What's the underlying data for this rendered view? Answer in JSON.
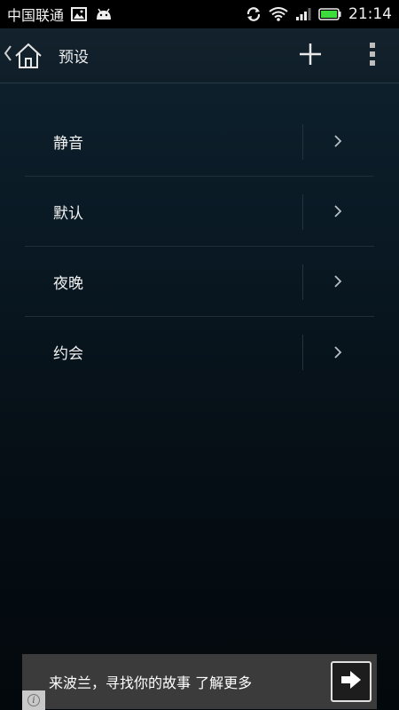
{
  "status_bar": {
    "carrier": "中国联通",
    "time": "21:14",
    "icons": [
      "image-icon",
      "android-icon",
      "sync-icon",
      "wifi-icon",
      "signal-icon",
      "battery-icon"
    ]
  },
  "action_bar": {
    "title": "预设",
    "icons": [
      "back-chevron-icon",
      "home-icon",
      "add-icon",
      "overflow-menu-icon"
    ]
  },
  "presets": {
    "items": [
      {
        "label": "静音"
      },
      {
        "label": "默认"
      },
      {
        "label": "夜晚"
      },
      {
        "label": "约会"
      }
    ]
  },
  "ad": {
    "text": "来波兰，寻找你的故事 了解更多",
    "info_glyph": "i"
  },
  "colors": {
    "status_bar_bg": "#000000",
    "background_top": "#0f2330",
    "background_bottom": "#03080c",
    "battery_green": "#3ddc3d",
    "ad_bg": "#3b3b3b"
  }
}
